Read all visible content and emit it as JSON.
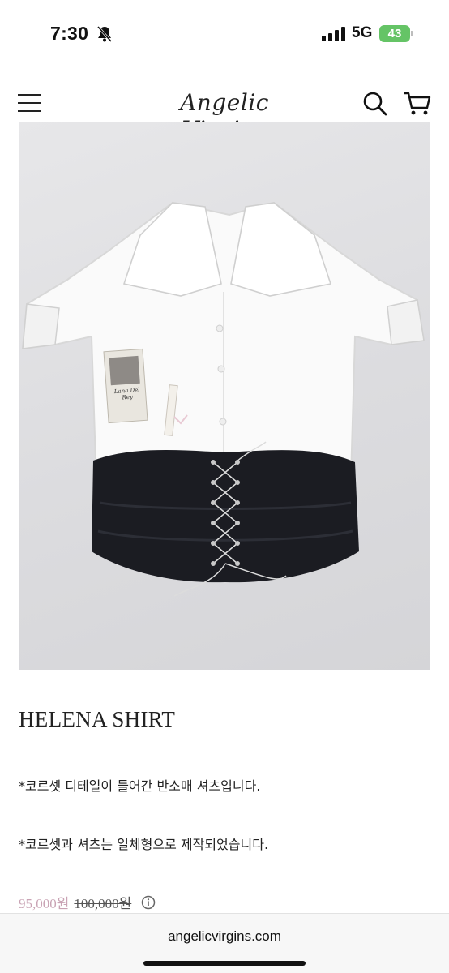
{
  "status_bar": {
    "time": "7:30",
    "network": "5G",
    "battery": "43"
  },
  "header": {
    "brand": "Angelic Virgins",
    "icons": [
      "menu-icon",
      "search-icon",
      "cart-icon"
    ]
  },
  "product": {
    "image_label": "Lana Del Rey",
    "title": "HELENA SHIRT",
    "description": [
      "*코르셋 디테일이 들어간 반소매 셔츠입니다.",
      "*코르셋과 셔츠는 일체형으로 제작되었습니다."
    ],
    "sale_price": "95,000원",
    "original_price": "100,000원"
  },
  "browser": {
    "url": "angelicvirgins.com"
  },
  "colors": {
    "sale_price": "#c9a3b4",
    "battery": "#65c466",
    "background": "#ffffff",
    "image_bg": "#dedee1"
  }
}
